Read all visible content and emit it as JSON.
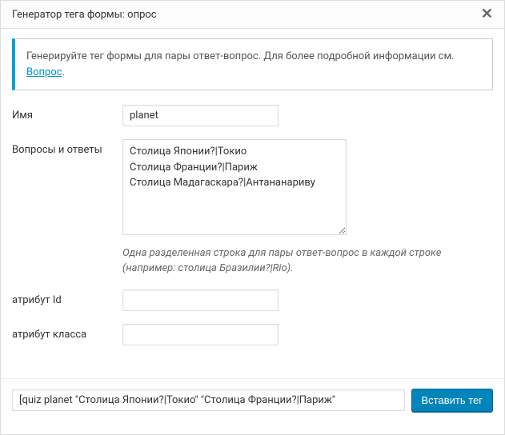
{
  "titlebar": {
    "title": "Генератор тега формы: опрос"
  },
  "info": {
    "text_before": "Генерируйте тег формы для пары ответ-вопрос. Для более подробной информации см. ",
    "link_text": "Вопрос",
    "text_after": "."
  },
  "form": {
    "name_label": "Имя",
    "name_value": "planet",
    "qa_label": "Вопросы и ответы",
    "qa_value": "Столица Японии?|Токио\nСтолица Франции?|Париж\nСтолица Мадагаскара?|Антананариву",
    "qa_hint": "Одна разделенная строка для пары ответ-вопрос в каждой строке (например: столица Бразилии?|Rio).",
    "id_label": "атрибут Id",
    "id_value": "",
    "class_label": "атрибут класса",
    "class_value": ""
  },
  "footer": {
    "shortcode": "[quiz planet \"Столица Японии?|Токио\" \"Столица Франции?|Париж\"",
    "insert_label": "Вставить тег"
  }
}
